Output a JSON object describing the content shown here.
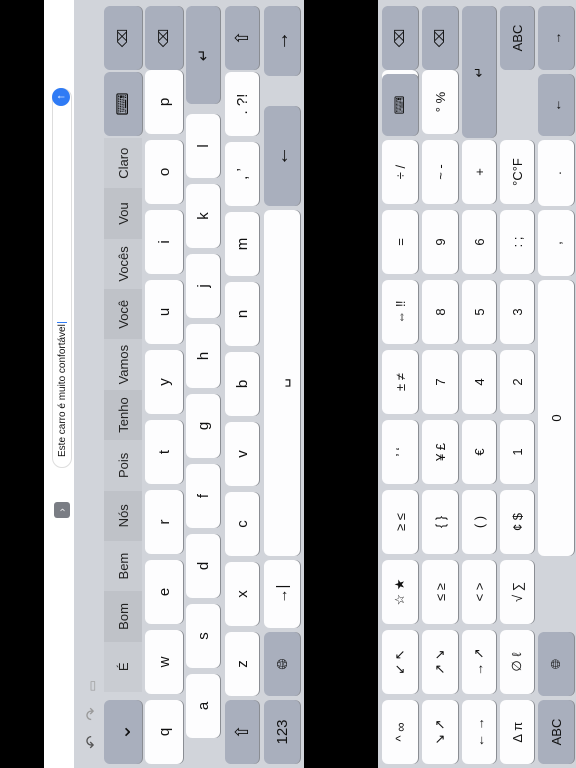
{
  "text_field": {
    "value": "Este carro é muito confortável"
  },
  "toolbar": {
    "undo_icon": "undo-icon",
    "redo_icon": "redo-icon",
    "paste_icon": "paste-icon",
    "chevron": "›"
  },
  "suggestions": [
    "É",
    "Bom",
    "Bem",
    "Nós",
    "Pois",
    "Tenho",
    "Vamos",
    "Você",
    "Vocês",
    "Vou",
    "Claro"
  ],
  "letters": {
    "row1": [
      "q",
      "w",
      "e",
      "r",
      "t",
      "y",
      "u",
      "i",
      "o",
      "p"
    ],
    "row2": [
      "a",
      "s",
      "d",
      "f",
      "g",
      "h",
      "j",
      "k",
      "l"
    ],
    "row3": [
      "z",
      "x",
      "c",
      "v",
      "b",
      "n",
      "m",
      ", ’",
      ". ?!"
    ],
    "space": "␣",
    "numbers_key": "123",
    "tab": "→|",
    "keyboard_toggle": "⌨",
    "globe_icon": "globe-icon"
  },
  "symbols": {
    "col1": [
      "^ ∞",
      "↖ ↙",
      "← →",
      "∆ π",
      "☆ ★",
      "≤ ≥",
      "≥ ≤"
    ],
    "col_rows": [
      [
        "^ ∞",
        "↙ ↖",
        "☆ ★",
        "≥ ≤",
        "’ ‘",
        "± ≠",
        "⇔ ‼",
        "=",
        "÷ /",
        "× •"
      ],
      [
        "↘ ↗",
        "↗ ↘",
        "≤ ≥",
        "{ }",
        "¥ £",
        "7",
        "8",
        "9",
        "~ -",
        "° %"
      ],
      [
        "← →",
        "→ ↗",
        "< >",
        "( )",
        "€",
        "4",
        "5",
        "6",
        "+"
      ],
      [
        "∆ π",
        "∅ ℓ",
        "√ ∑",
        "¢ $",
        "1",
        "2",
        "3",
        ": ;",
        "°C°F"
      ],
      [
        "ABC",
        "0",
        ",",
        "."
      ]
    ],
    "abc": "ABC",
    "apple_icon": "apple-icon"
  }
}
